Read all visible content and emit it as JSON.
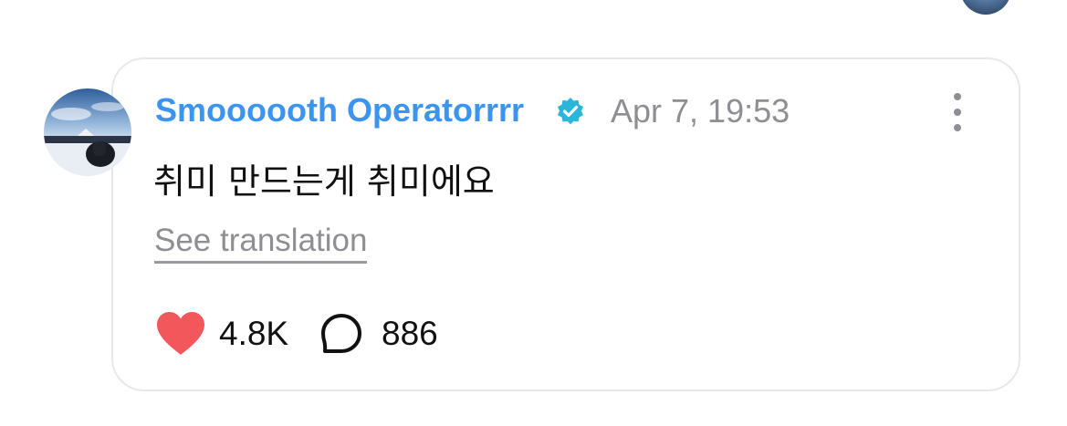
{
  "top_fragment": "· · · · · · · · · · ·",
  "post": {
    "username": "Smoooooth Operatorrrr",
    "verified": true,
    "timestamp": "Apr 7, 19:53",
    "text": "취미 만드는게 취미에요",
    "translate_label": "See translation",
    "likes": "4.8K",
    "comments": "886"
  },
  "icons": {
    "verified": "verified-badge-icon",
    "more": "more-vertical-icon",
    "like": "heart-icon",
    "comment": "comment-bubble-icon"
  },
  "colors": {
    "username": "#3b94f0",
    "verified": "#29b6d9",
    "heart": "#f2575b",
    "muted": "#8e8e93",
    "border": "#e8e8ec"
  }
}
